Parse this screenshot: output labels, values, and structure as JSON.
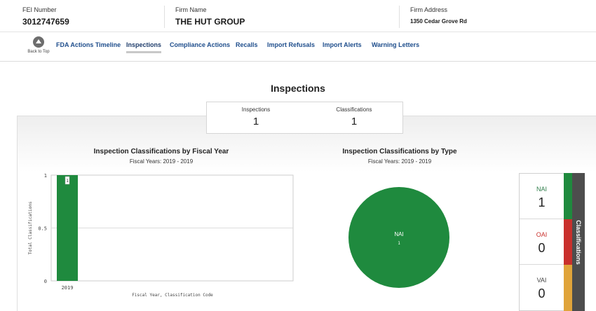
{
  "header": {
    "fei_label": "FEI Number",
    "fei_value": "3012747659",
    "firm_label": "Firm Name",
    "firm_value": "THE HUT GROUP",
    "address_label": "Firm Address",
    "address_value": "1350 Cedar Grove Rd"
  },
  "nav": {
    "back_label": "Back to Top",
    "items": [
      "FDA Actions Timeline",
      "Inspections",
      "Compliance Actions",
      "Recalls",
      "Import Refusals",
      "Import Alerts",
      "Warning Letters"
    ],
    "active": "Inspections"
  },
  "section_title": "Inspections",
  "summary": {
    "inspections_label": "Inspections",
    "inspections_value": "1",
    "classifications_label": "Classifications",
    "classifications_value": "1"
  },
  "charts": {
    "bar_title": "Inspection Classifications by Fiscal Year",
    "bar_subtitle": "Fiscal Years: 2019 - 2019",
    "pie_title": "Inspection Classifications by Type",
    "pie_subtitle": "Fiscal Years: 2019 - 2019"
  },
  "chart_data": [
    {
      "type": "bar",
      "categories": [
        "2019"
      ],
      "values": [
        1
      ],
      "data_labels": [
        "1"
      ],
      "xlabel": "Fiscal Year, Classification Code",
      "ylabel": "Total Classifications",
      "ylim": [
        0,
        1
      ],
      "yticks": [
        "0",
        "0.5",
        "1"
      ],
      "grid": true,
      "color": "#1f8a3e"
    },
    {
      "type": "pie",
      "labels": [
        "NAI"
      ],
      "values": [
        1
      ],
      "data_labels": [
        "1"
      ],
      "colors": [
        "#1f8a3e"
      ]
    }
  ],
  "legend": {
    "title": "Classifications",
    "items": [
      {
        "key": "NAI",
        "value": "1",
        "color": "#1f8a3e",
        "text_color": "#2e7d4a"
      },
      {
        "key": "OAI",
        "value": "0",
        "color": "#c9302c",
        "text_color": "#c9302c"
      },
      {
        "key": "VAI",
        "value": "0",
        "color": "#e0a43a",
        "text_color": "#444444"
      }
    ]
  }
}
